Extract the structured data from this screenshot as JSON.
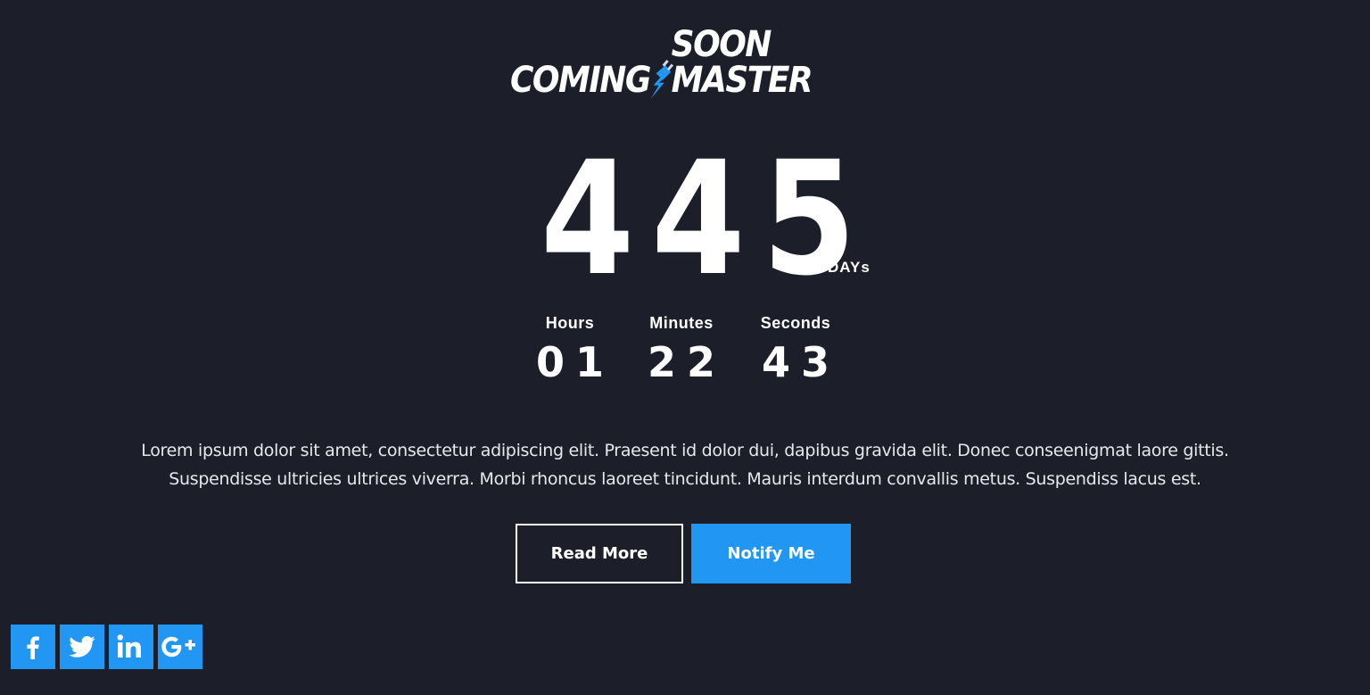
{
  "logo": {
    "left_text": "COMING",
    "right_text": "SOON MASTER",
    "icon": "plug-bolt-icon",
    "accent_color": "#2196f3"
  },
  "countdown": {
    "days": {
      "value": "445",
      "label": "DAYs"
    },
    "hours": {
      "value": "01",
      "label": "Hours"
    },
    "minutes": {
      "value": "22",
      "label": "Minutes"
    },
    "seconds": {
      "value": "43",
      "label": "Seconds"
    }
  },
  "description": "Lorem ipsum dolor sit amet, consectetur adipiscing elit. Praesent id dolor dui, dapibus gravida elit. Donec conseenigmat laore gittis. Suspendisse ultricies ultrices viverra. Morbi rhoncus laoreet tincidunt. Mauris interdum convallis metus. Suspendiss lacus est.",
  "buttons": {
    "read_more": "Read More",
    "notify_me": "Notify Me"
  },
  "social": [
    {
      "name": "facebook",
      "icon": "facebook-icon"
    },
    {
      "name": "twitter",
      "icon": "twitter-icon"
    },
    {
      "name": "linkedin",
      "icon": "linkedin-icon"
    },
    {
      "name": "google-plus",
      "icon": "google-plus-icon"
    }
  ],
  "colors": {
    "background": "#1c1f29",
    "accent": "#2196f3",
    "text": "#ffffff"
  }
}
